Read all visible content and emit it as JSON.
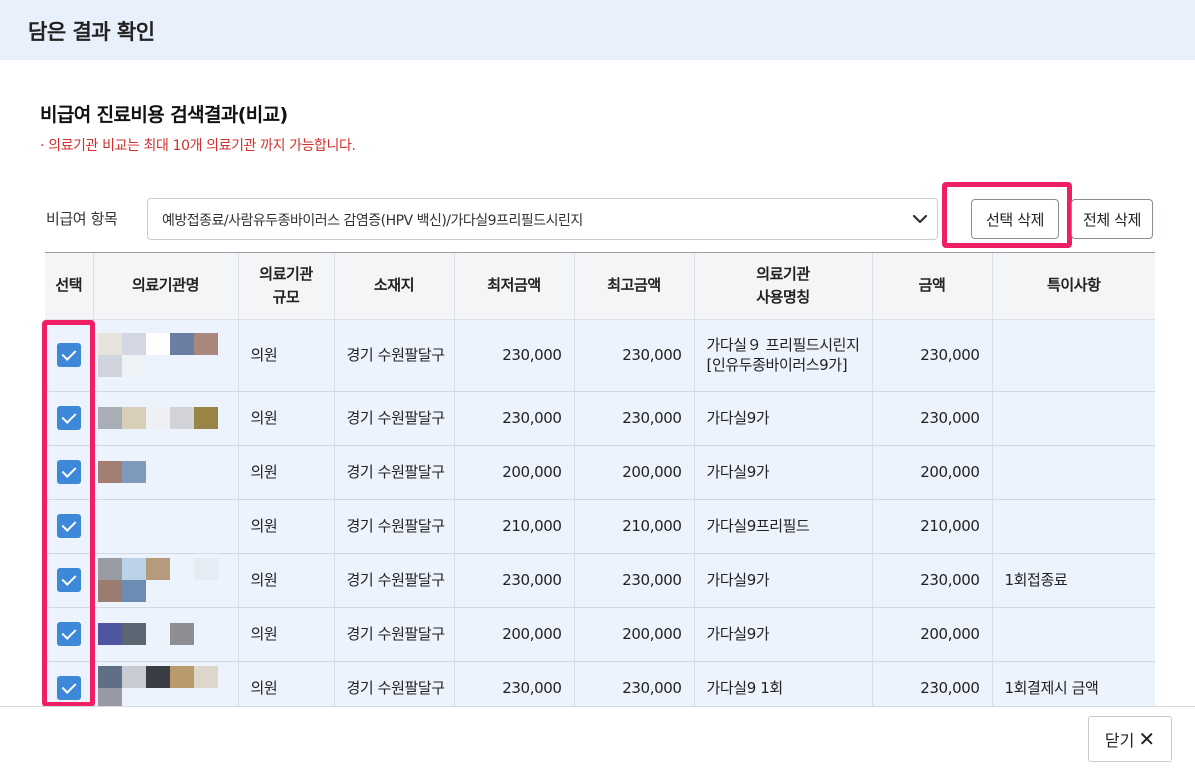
{
  "header": {
    "title": "담은 결과 확인"
  },
  "section": {
    "title": "비급여 진료비용 검색결과(비교)",
    "notice": "· 의료기관 비교는 최대 10개 의료기관 까지 가능합니다."
  },
  "filter": {
    "label": "비급여 항목",
    "selected": "예방접종료/사람유두종바이러스 감염증(HPV 백신)/가다실9프리필드시린지",
    "chevron_icon": "chevron-down-icon"
  },
  "actions": {
    "delete_selected": "선택 삭제",
    "delete_all": "전체 삭제"
  },
  "table": {
    "columns": [
      "선택",
      "의료기관명",
      "의료기관\n규모",
      "소재지",
      "최저금액",
      "최고금액",
      "의료기관\n사용명칭",
      "금액",
      "특이사항"
    ],
    "rows": [
      {
        "checked": true,
        "name_pixels": [
          "#e6e3dc",
          "#d2d7e3",
          "#ffffff",
          "#6b7ea3",
          "#a9877a",
          "#cfd4df",
          "#eef1f6"
        ],
        "scale": "의원",
        "location": "경기 수원팔달구",
        "min": "230,000",
        "max": "230,000",
        "usage_name": "가다실９ 프리필드시린지[인유두종바이러스9가]",
        "amount": "230,000",
        "note": ""
      },
      {
        "checked": true,
        "name_pixels": [
          "#a9adb6",
          "#d9cfb8",
          "#eef0f3",
          "#d1d3d9",
          "#9a8445"
        ],
        "scale": "의원",
        "location": "경기 수원팔달구",
        "min": "230,000",
        "max": "230,000",
        "usage_name": "가다실9가",
        "amount": "230,000",
        "note": ""
      },
      {
        "checked": true,
        "name_pixels": [
          "#a37e72",
          "#7f9bbb"
        ],
        "scale": "의원",
        "location": "경기 수원팔달구",
        "min": "200,000",
        "max": "200,000",
        "usage_name": "가다실9가",
        "amount": "200,000",
        "note": ""
      },
      {
        "checked": true,
        "name_pixels": [],
        "scale": "의원",
        "location": "경기 수원팔달구",
        "min": "210,000",
        "max": "210,000",
        "usage_name": "가다실9프리필드",
        "amount": "210,000",
        "note": ""
      },
      {
        "checked": true,
        "name_pixels": [
          "#9a9ca3",
          "#bcd2e8",
          "#b59a7c",
          "#edf3fc",
          "#e6ecf4",
          "#9a7c70",
          "#6b8db4"
        ],
        "scale": "의원",
        "location": "경기 수원팔달구",
        "min": "230,000",
        "max": "230,000",
        "usage_name": "가다실9가",
        "amount": "230,000",
        "note": "1회접종료"
      },
      {
        "checked": true,
        "name_pixels": [
          "#4e55a1",
          "#5b6673",
          "#edf3fc",
          "#8c8e92"
        ],
        "scale": "의원",
        "location": "경기 수원팔달구",
        "min": "200,000",
        "max": "200,000",
        "usage_name": "가다실9가",
        "amount": "200,000",
        "note": ""
      },
      {
        "checked": true,
        "name_pixels": [
          "#5f6f86",
          "#c9cbd2",
          "#3a3d44",
          "#b99a6c",
          "#dcd7ca",
          "#979aa2"
        ],
        "scale": "의원",
        "location": "경기 수원팔달구",
        "min": "230,000",
        "max": "230,000",
        "usage_name": "가다실9 1회",
        "amount": "230,000",
        "note": "1회결제시 금액"
      }
    ]
  },
  "footer": {
    "close_label": "닫기",
    "close_icon": "close-icon"
  }
}
